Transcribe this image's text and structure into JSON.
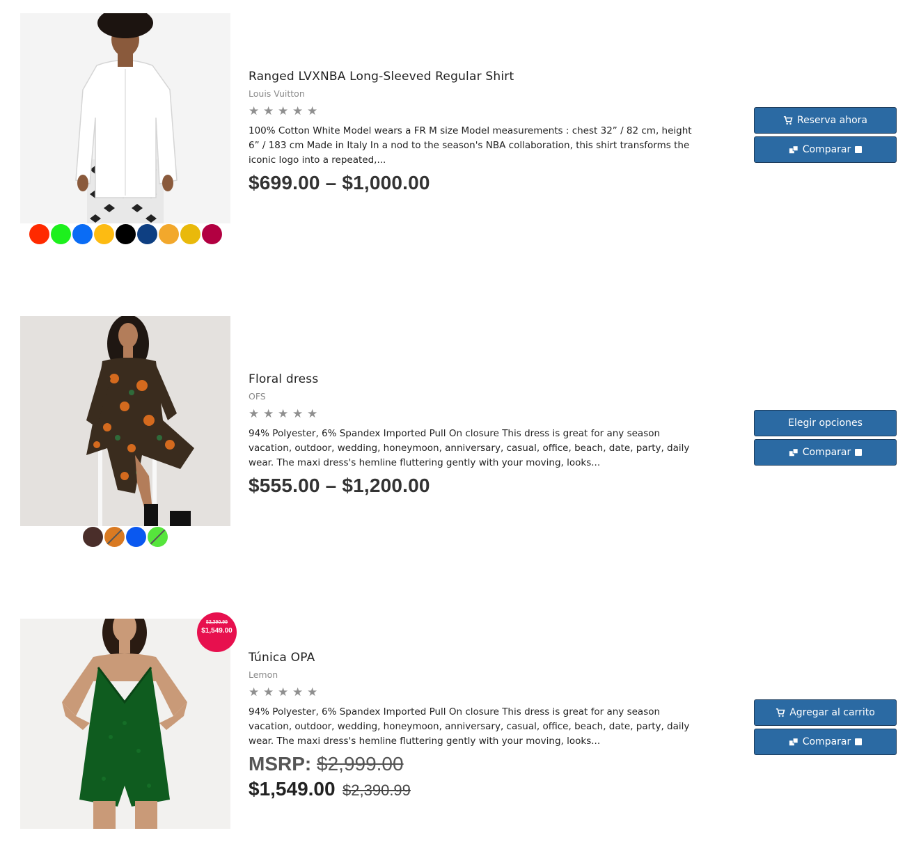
{
  "products": [
    {
      "title": "Ranged LVXNBA Long-Sleeved Regular Shirt",
      "brand": "Louis Vuitton",
      "rating": "★★★★★",
      "description": "100% Cotton White Model wears a FR M size Model measurements : chest 32” / 82 cm, height 6” / 183 cm Made in Italy In a nod to the season's NBA collaboration, this shirt transforms the iconic logo into a repeated,...",
      "price": "$699.00 – $1,000.00",
      "primary_button": "Reserva ahora",
      "compare_button": "Comparar",
      "swatches": [
        "#ff2a00",
        "#1df01d",
        "#0a6cf5",
        "#fdbb12",
        "#000000",
        "#0e3f82",
        "#f2a82c",
        "#e9b90b",
        "#b20041"
      ]
    },
    {
      "title": "Floral dress",
      "brand": "OFS",
      "rating": "★★★★★",
      "description": "94% Polyester, 6% Spandex Imported Pull On closure This dress is great for any season vacation, outdoor, wedding, honeymoon, anniversary, casual, office, beach, date, party, daily wear. The maxi dress's hemline fluttering gently with your moving, looks...",
      "price": "$555.00 – $1,200.00",
      "primary_button": "Elegir opciones",
      "compare_button": "Comparar",
      "swatches": [
        "#4a2e2a",
        "#d97a22",
        "#0a58f0",
        "#56e53c"
      ]
    },
    {
      "title": "Túnica OPA",
      "brand": "Lemon",
      "rating": "★★★★★",
      "description": "94% Polyester, 6% Spandex Imported Pull On closure This dress is great for any season vacation, outdoor, wedding, honeymoon, anniversary, casual, office, beach, date, party, daily wear. The maxi dress's hemline fluttering gently with your moving, looks...",
      "msrp_label": "MSRP:",
      "msrp_price": "$2,999.00",
      "sale_price": "$1,549.00",
      "regular_price": "$2,390.99",
      "badge_old": "$2,390.99",
      "badge_new": "$1,549.00",
      "primary_button": "Agregar al carrito",
      "compare_button": "Comparar"
    }
  ],
  "colors": {
    "button_bg": "#2b6aa3",
    "badge_bg": "#e7104e",
    "star": "#8f8f8f"
  },
  "icons": {
    "cart": "cart-icon",
    "compare": "compare-icon",
    "checkbox": "checkbox-icon",
    "star": "star-icon"
  }
}
